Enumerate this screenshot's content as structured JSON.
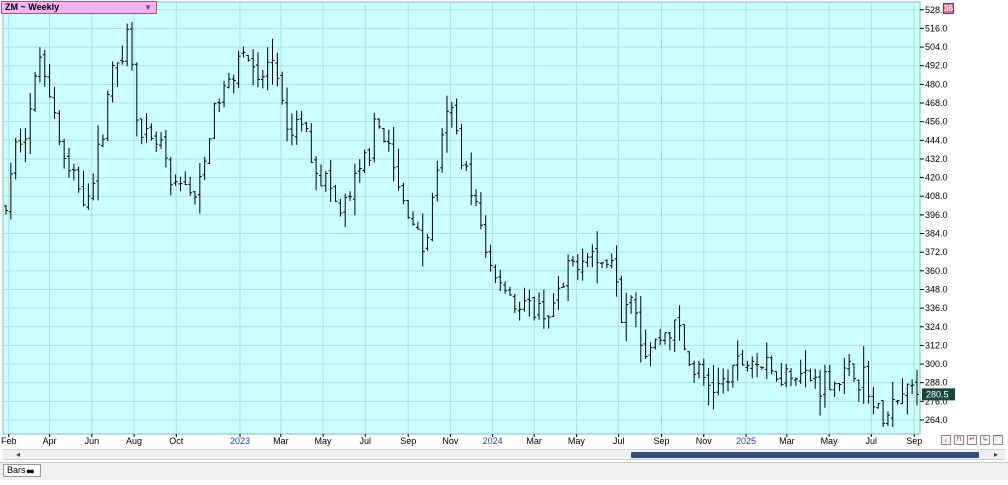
{
  "header": {
    "symbol_label": "ZM ~ Weekly",
    "badge": "36"
  },
  "status": {
    "study_tab": "Bars"
  },
  "colors": {
    "plot_bg": "#ccffff",
    "grid": "#a8e0e0",
    "bars": "#000000",
    "axis_text": "#000000",
    "month_text": "#000000",
    "year_text": "#1f3fbf"
  },
  "chart_data": {
    "type": "ohlc",
    "title": "",
    "xlabel": "",
    "ylabel": "",
    "ylim": [
      255,
      533
    ],
    "yticks": [
      528.0,
      516.0,
      504.0,
      492.0,
      480.0,
      468.0,
      456.0,
      444.0,
      432.0,
      420.0,
      408.0,
      396.0,
      384.0,
      372.0,
      360.0,
      348.0,
      336.0,
      324.0,
      312.0,
      300.0,
      288.0,
      276.0,
      264.0
    ],
    "ytick_labels": [
      "528.0",
      "516.0",
      "504.0",
      "492.0",
      "480.0",
      "468.0",
      "456.0",
      "444.0",
      "432.0",
      "420.0",
      "408.0",
      "396.0",
      "384.0",
      "372.0",
      "360.0",
      "348.0",
      "336.0",
      "324.0",
      "312.0",
      "300.0",
      "288.0",
      "276.0",
      "264.0"
    ],
    "x_start": "2022-01-28",
    "x_end": "2025-09-05",
    "x_labels": [
      {
        "label": "Feb",
        "date": "2022-02-01",
        "year": false
      },
      {
        "label": "Apr",
        "date": "2022-04-01",
        "year": false
      },
      {
        "label": "Jun",
        "date": "2022-06-01",
        "year": false
      },
      {
        "label": "Aug",
        "date": "2022-08-01",
        "year": false
      },
      {
        "label": "Oct",
        "date": "2022-10-01",
        "year": false
      },
      {
        "label": "2023",
        "date": "2023-01-01",
        "year": true
      },
      {
        "label": "Mar",
        "date": "2023-03-01",
        "year": false
      },
      {
        "label": "May",
        "date": "2023-05-01",
        "year": false
      },
      {
        "label": "Jul",
        "date": "2023-07-01",
        "year": false
      },
      {
        "label": "Sep",
        "date": "2023-09-01",
        "year": false
      },
      {
        "label": "Nov",
        "date": "2023-11-01",
        "year": false
      },
      {
        "label": "2024",
        "date": "2024-01-01",
        "year": true
      },
      {
        "label": "Mar",
        "date": "2024-03-01",
        "year": false
      },
      {
        "label": "May",
        "date": "2024-05-01",
        "year": false
      },
      {
        "label": "Jul",
        "date": "2024-07-01",
        "year": false
      },
      {
        "label": "Sep",
        "date": "2024-09-01",
        "year": false
      },
      {
        "label": "Nov",
        "date": "2024-11-01",
        "year": false
      },
      {
        "label": "2025",
        "date": "2025-01-01",
        "year": true
      },
      {
        "label": "Mar",
        "date": "2025-03-01",
        "year": false
      },
      {
        "label": "May",
        "date": "2025-05-01",
        "year": false
      },
      {
        "label": "Jul",
        "date": "2025-07-01",
        "year": false
      },
      {
        "label": "Sep",
        "date": "2025-09-01",
        "year": false
      }
    ],
    "last_price": 280.5,
    "last_price_label": "280.5",
    "anchors": [
      [
        "2022-01-28",
        400
      ],
      [
        "2022-02-15",
        448
      ],
      [
        "2022-03-01",
        455
      ],
      [
        "2022-03-20",
        505
      ],
      [
        "2022-04-10",
        455
      ],
      [
        "2022-04-25",
        425
      ],
      [
        "2022-05-20",
        410
      ],
      [
        "2022-06-05",
        418
      ],
      [
        "2022-06-25",
        478
      ],
      [
        "2022-07-25",
        515
      ],
      [
        "2022-08-10",
        443
      ],
      [
        "2022-09-10",
        440
      ],
      [
        "2022-09-25",
        408
      ],
      [
        "2022-10-15",
        418
      ],
      [
        "2022-11-01",
        405
      ],
      [
        "2022-11-25",
        465
      ],
      [
        "2022-12-15",
        480
      ],
      [
        "2023-01-05",
        508
      ],
      [
        "2023-01-25",
        478
      ],
      [
        "2023-02-20",
        498
      ],
      [
        "2023-03-10",
        443
      ],
      [
        "2023-03-30",
        458
      ],
      [
        "2023-04-25",
        423
      ],
      [
        "2023-05-10",
        415
      ],
      [
        "2023-05-25",
        395
      ],
      [
        "2023-06-20",
        418
      ],
      [
        "2023-07-10",
        445
      ],
      [
        "2023-07-25",
        455
      ],
      [
        "2023-08-20",
        408
      ],
      [
        "2023-09-10",
        392
      ],
      [
        "2023-09-25",
        370
      ],
      [
        "2023-10-15",
        435
      ],
      [
        "2023-11-01",
        465
      ],
      [
        "2023-11-15",
        440
      ],
      [
        "2023-12-05",
        408
      ],
      [
        "2023-12-25",
        365
      ],
      [
        "2024-01-20",
        350
      ],
      [
        "2024-02-10",
        333
      ],
      [
        "2024-03-01",
        335
      ],
      [
        "2024-03-25",
        333
      ],
      [
        "2024-04-10",
        347
      ],
      [
        "2024-04-25",
        363
      ],
      [
        "2024-05-20",
        375
      ],
      [
        "2024-06-05",
        362
      ],
      [
        "2024-06-25",
        372
      ],
      [
        "2024-07-05",
        335
      ],
      [
        "2024-07-20",
        353
      ],
      [
        "2024-08-05",
        310
      ],
      [
        "2024-08-20",
        312
      ],
      [
        "2024-09-10",
        322
      ],
      [
        "2024-09-25",
        325
      ],
      [
        "2024-10-10",
        300
      ],
      [
        "2024-11-01",
        290
      ],
      [
        "2024-11-25",
        284
      ],
      [
        "2024-12-15",
        298
      ],
      [
        "2025-01-10",
        303
      ],
      [
        "2025-02-10",
        293
      ],
      [
        "2025-03-10",
        297
      ],
      [
        "2025-04-01",
        290
      ],
      [
        "2025-05-10",
        289
      ],
      [
        "2025-06-01",
        294
      ],
      [
        "2025-06-25",
        290
      ],
      [
        "2025-07-05",
        269
      ],
      [
        "2025-07-25",
        266
      ],
      [
        "2025-08-10",
        276
      ],
      [
        "2025-08-25",
        287
      ],
      [
        "2025-09-05",
        280.5
      ]
    ]
  }
}
